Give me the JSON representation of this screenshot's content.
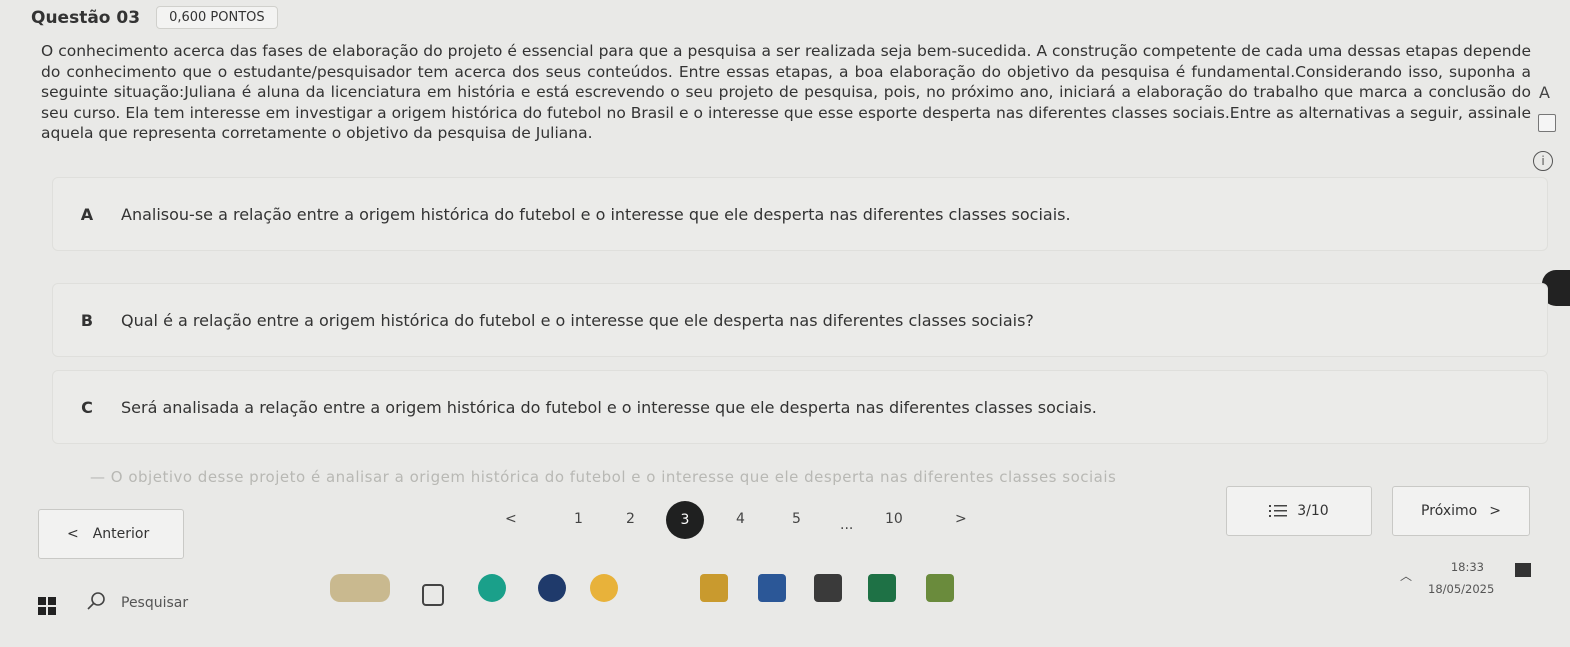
{
  "question": {
    "title": "Questão 03",
    "points": "0,600 PONTOS",
    "statement": "O conhecimento acerca das fases de elaboração do projeto é essencial para que a pesquisa a ser realizada seja bem-sucedida. A construção competente de cada uma dessas etapas depende do conhecimento que o estudante/pesquisador tem acerca dos seus conteúdos. Entre essas etapas, a boa elaboração do objetivo da pesquisa é fundamental.Considerando isso, suponha a seguinte situação:Juliana é aluna da licenciatura em história e está escrevendo o seu projeto de pesquisa, pois, no próximo ano, iniciará a elaboração do trabalho que marca a conclusão do seu curso. Ela tem interesse em investigar a origem histórica do futebol no Brasil e o interesse que esse esporte desperta nas diferentes classes sociais.Entre as alternativas a seguir, assinale aquela que representa corretamente o objetivo da pesquisa de Juliana."
  },
  "side": {
    "label": "A",
    "info": "i"
  },
  "options": [
    {
      "letter": "A",
      "text": "Analisou-se a relação entre a origem histórica do futebol e o interesse que ele desperta nas diferentes classes sociais."
    },
    {
      "letter": "B",
      "text": "Qual é a relação entre a origem histórica do futebol e o interesse que ele desperta nas diferentes classes sociais?"
    },
    {
      "letter": "C",
      "text": "Será analisada a relação entre a origem histórica do futebol e o interesse que ele desperta nas diferentes classes sociais."
    }
  ],
  "faded_text": "—  O objetivo desse projeto é analisar a origem histórica do futebol e o interesse que ele desperta nas diferentes classes sociais",
  "nav": {
    "prev": "Anterior",
    "prev_arrow": "<",
    "next": "Próximo",
    "next_arrow": ">",
    "count": "3/10",
    "pages": [
      "<",
      "1",
      "2",
      "3",
      "4",
      "5",
      "...",
      "10",
      ">"
    ],
    "current": "3"
  },
  "taskbar": {
    "search": "Pesquisar",
    "time": "18:33",
    "date": "18/05/2025",
    "apps": [
      "widgets-icon",
      "taskview-icon",
      "edge-icon",
      "teams-icon",
      "chrome-icon",
      "files-icon",
      "word-icon",
      "calculator-icon",
      "excel-icon",
      "store-icon"
    ],
    "colors": {
      "active_page": "#1f2020",
      "edge": "#1aa08a",
      "word": "#2b5797",
      "excel": "#1e7145"
    }
  }
}
